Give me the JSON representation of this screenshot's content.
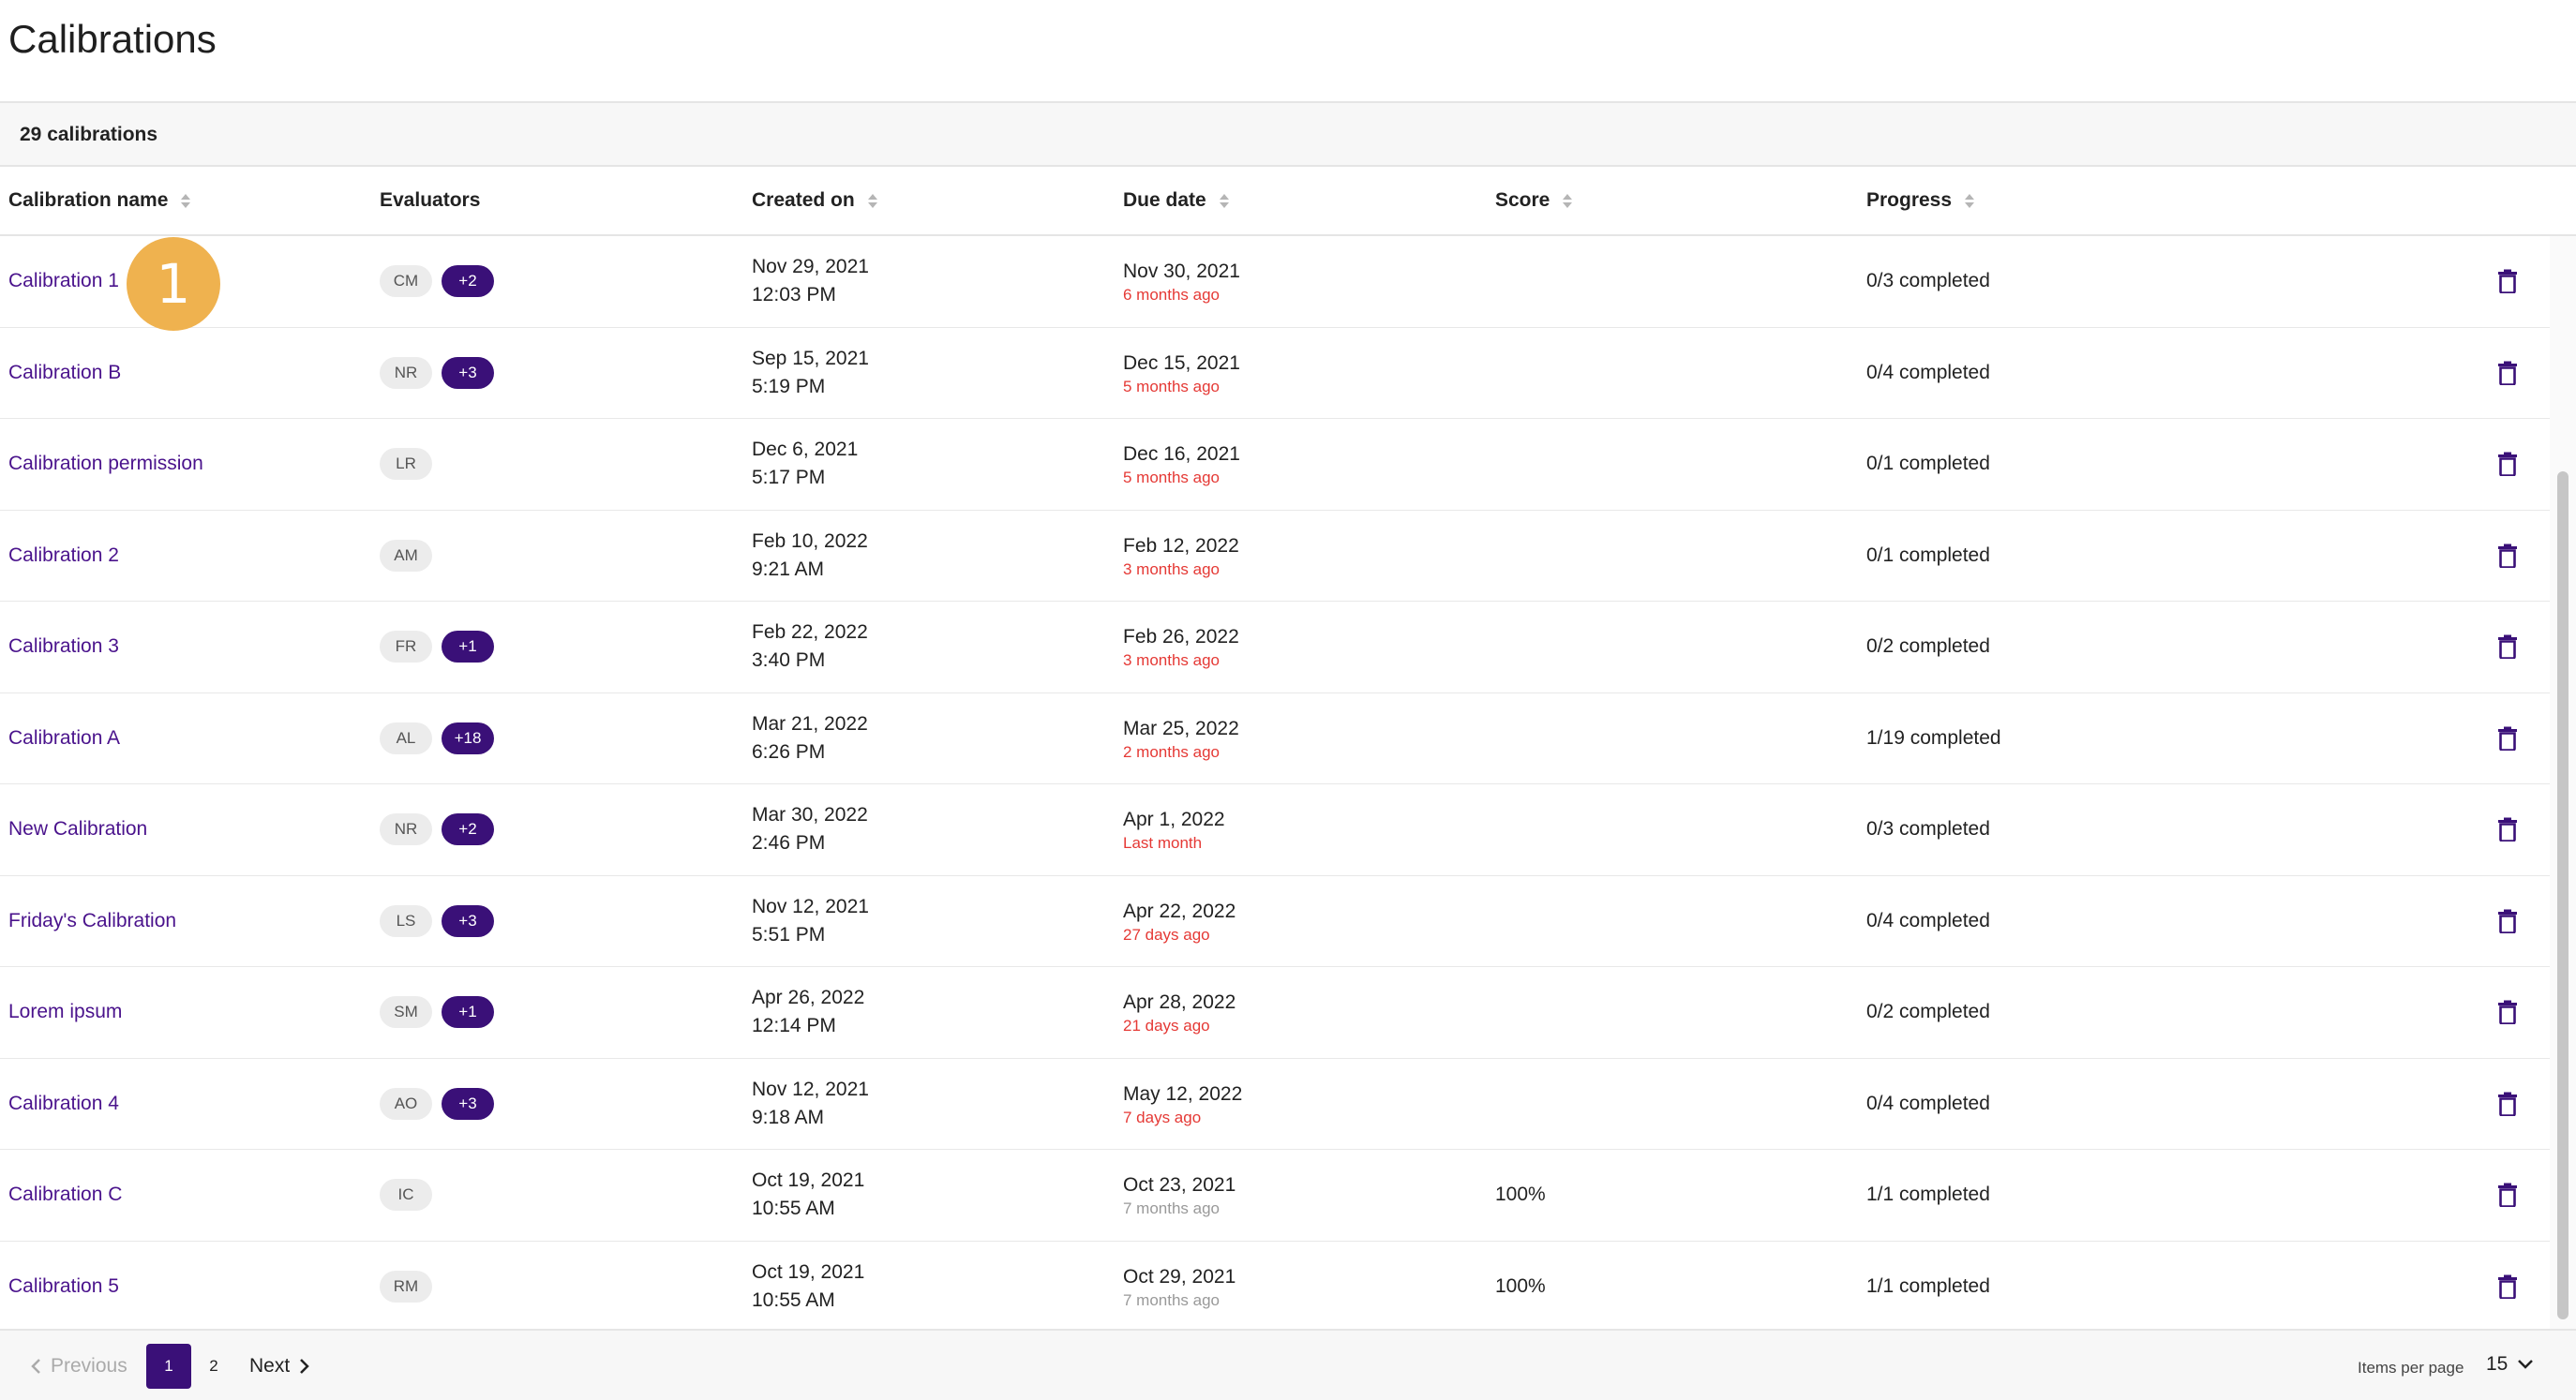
{
  "page": {
    "title": "Calibrations",
    "count_label": "29 calibrations"
  },
  "colors": {
    "accent": "#3a1078",
    "link": "#4a138c",
    "overdue": "#e53935",
    "muted": "#999999",
    "badge": "#efb24f"
  },
  "table": {
    "columns": [
      {
        "label": "Calibration name",
        "sortable": true
      },
      {
        "label": "Evaluators",
        "sortable": false
      },
      {
        "label": "Created on",
        "sortable": true
      },
      {
        "label": "Due date",
        "sortable": true
      },
      {
        "label": "Score",
        "sortable": true
      },
      {
        "label": "Progress",
        "sortable": true
      }
    ],
    "rows": [
      {
        "name": "Calibration 1",
        "evaluator": "CM",
        "extra": "+2",
        "created_date": "Nov 29, 2021",
        "created_time": "12:03 PM",
        "due_date": "Nov 30, 2021",
        "due_ago": "6 months ago",
        "score": "",
        "progress": "0/3 completed"
      },
      {
        "name": "Calibration B",
        "evaluator": "NR",
        "extra": "+3",
        "created_date": "Sep 15, 2021",
        "created_time": "5:19 PM",
        "due_date": "Dec 15, 2021",
        "due_ago": "5 months ago",
        "score": "",
        "progress": "0/4 completed"
      },
      {
        "name": "Calibration permission",
        "evaluator": "LR",
        "extra": "",
        "created_date": "Dec 6, 2021",
        "created_time": "5:17 PM",
        "due_date": "Dec 16, 2021",
        "due_ago": "5 months ago",
        "score": "",
        "progress": "0/1 completed"
      },
      {
        "name": "Calibration 2",
        "evaluator": "AM",
        "extra": "",
        "created_date": "Feb 10, 2022",
        "created_time": "9:21 AM",
        "due_date": "Feb 12, 2022",
        "due_ago": "3 months ago",
        "score": "",
        "progress": "0/1 completed"
      },
      {
        "name": "Calibration 3",
        "evaluator": "FR",
        "extra": "+1",
        "created_date": "Feb 22, 2022",
        "created_time": "3:40 PM",
        "due_date": "Feb 26, 2022",
        "due_ago": "3 months ago",
        "score": "",
        "progress": "0/2 completed"
      },
      {
        "name": "Calibration A",
        "evaluator": "AL",
        "extra": "+18",
        "created_date": "Mar 21, 2022",
        "created_time": "6:26 PM",
        "due_date": "Mar 25, 2022",
        "due_ago": "2 months ago",
        "score": "",
        "progress": "1/19 completed"
      },
      {
        "name": "New Calibration",
        "evaluator": "NR",
        "extra": "+2",
        "created_date": "Mar 30, 2022",
        "created_time": "2:46 PM",
        "due_date": "Apr 1, 2022",
        "due_ago": "Last month",
        "score": "",
        "progress": "0/3 completed"
      },
      {
        "name": "Friday's Calibration",
        "evaluator": "LS",
        "extra": "+3",
        "created_date": "Nov 12, 2021",
        "created_time": "5:51 PM",
        "due_date": "Apr 22, 2022",
        "due_ago": "27 days ago",
        "score": "",
        "progress": "0/4 completed"
      },
      {
        "name": "Lorem ipsum",
        "evaluator": "SM",
        "extra": "+1",
        "created_date": "Apr 26, 2022",
        "created_time": "12:14 PM",
        "due_date": "Apr 28, 2022",
        "due_ago": "21 days ago",
        "score": "",
        "progress": "0/2 completed"
      },
      {
        "name": "Calibration 4",
        "evaluator": "AO",
        "extra": "+3",
        "created_date": "Nov 12, 2021",
        "created_time": "9:18 AM",
        "due_date": "May 12, 2022",
        "due_ago": "7 days ago",
        "score": "",
        "progress": "0/4 completed"
      },
      {
        "name": "Calibration C",
        "evaluator": "IC",
        "extra": "",
        "created_date": "Oct 19, 2021",
        "created_time": "10:55 AM",
        "due_date": "Oct 23, 2021",
        "due_ago": "7 months ago",
        "due_muted": true,
        "score": "100%",
        "progress": "1/1 completed"
      },
      {
        "name": "Calibration 5",
        "evaluator": "RM",
        "extra": "",
        "created_date": "Oct 19, 2021",
        "created_time": "10:55 AM",
        "due_date": "Oct 29, 2021",
        "due_ago": "7 months ago",
        "due_muted": true,
        "score": "100%",
        "progress": "1/1 completed"
      }
    ],
    "row_action_icon": "trash-icon"
  },
  "step_badge": "1",
  "pagination": {
    "prev_label": "Previous",
    "pages": [
      "1",
      "2"
    ],
    "current": "1",
    "next_label": "Next"
  },
  "items_per_page": {
    "label": "Items per page",
    "value": "15"
  }
}
